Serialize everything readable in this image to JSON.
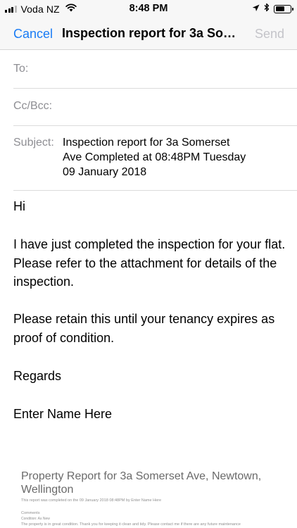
{
  "status_bar": {
    "carrier": "Voda NZ",
    "time": "8:48 PM",
    "battery_level": 0.6
  },
  "nav": {
    "cancel_label": "Cancel",
    "title": "Inspection report for 3a Somerset Ave Completed at 08:48PM Tuesday 09 January 2018",
    "send_label": "Send"
  },
  "fields": {
    "to_label": "To:",
    "cc_label": "Cc/Bcc:",
    "subject_label": "Subject:",
    "subject_lines": [
      "Inspection report for 3a Somerset",
      "Ave Completed at 08:48PM Tuesday",
      "09 January 2018"
    ]
  },
  "body": {
    "greeting": "Hi",
    "paragraph1": "I have just completed the inspection for your flat. Please refer to the attachment for details of the inspection.",
    "paragraph2": "Please retain this until your tenancy expires as proof of condition.",
    "signoff": "Regards",
    "name": "Enter Name Here"
  },
  "attachment": {
    "title": "Property Report for 3a Somerset Ave, Newtown, Wellington",
    "meta": "This report was completed on the 09 January 2018 08:48PM by Enter Name Here",
    "comments_label": "Comments",
    "condition": "Condition: As New",
    "note": "The property is in great condition. Thank you for keeping it clean and tidy. Please contact me if there are any future maintenance"
  },
  "icons": {
    "wifi": "wifi-icon",
    "location": "location-arrow-icon",
    "bluetooth": "bluetooth-icon",
    "battery": "battery-icon",
    "signal": "signal-icon"
  },
  "colors": {
    "accent": "#1a7cf5",
    "disabled": "#c4c4c9",
    "label_gray": "#8e8e93"
  }
}
